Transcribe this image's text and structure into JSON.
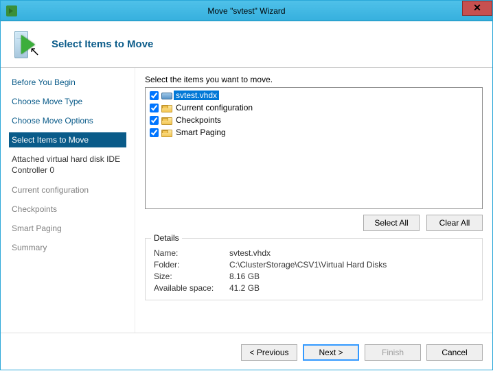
{
  "window": {
    "title": "Move \"svtest\" Wizard",
    "close_glyph": "✕"
  },
  "header": {
    "title": "Select Items to Move"
  },
  "sidebar": {
    "items": [
      {
        "label": "Before You Begin",
        "state": "link"
      },
      {
        "label": "Choose Move Type",
        "state": "link"
      },
      {
        "label": "Choose Move Options",
        "state": "link"
      },
      {
        "label": "Select Items to Move",
        "state": "selected"
      },
      {
        "label": "Attached virtual hard disk IDE Controller 0",
        "state": "sub"
      },
      {
        "label": "Current configuration",
        "state": "muted"
      },
      {
        "label": "Checkpoints",
        "state": "muted"
      },
      {
        "label": "Smart Paging",
        "state": "muted"
      },
      {
        "label": "Summary",
        "state": "muted"
      }
    ]
  },
  "main": {
    "instruction": "Select the items you want to move.",
    "items": [
      {
        "label": "svtest.vhdx",
        "checked": true,
        "icon": "disk",
        "selected": true
      },
      {
        "label": "Current configuration",
        "checked": true,
        "icon": "folder",
        "selected": false
      },
      {
        "label": "Checkpoints",
        "checked": true,
        "icon": "folder",
        "selected": false
      },
      {
        "label": "Smart Paging",
        "checked": true,
        "icon": "folder",
        "selected": false
      }
    ],
    "buttons": {
      "select_all": "Select All",
      "clear_all": "Clear All"
    },
    "details": {
      "legend": "Details",
      "rows": {
        "name_label": "Name:",
        "name_value": "svtest.vhdx",
        "folder_label": "Folder:",
        "folder_value": "C:\\ClusterStorage\\CSV1\\Virtual Hard Disks",
        "size_label": "Size:",
        "size_value": "8.16 GB",
        "avail_label": "Available space:",
        "avail_value": "41.2 GB"
      }
    }
  },
  "footer": {
    "previous": "< Previous",
    "next": "Next >",
    "finish": "Finish",
    "cancel": "Cancel"
  }
}
